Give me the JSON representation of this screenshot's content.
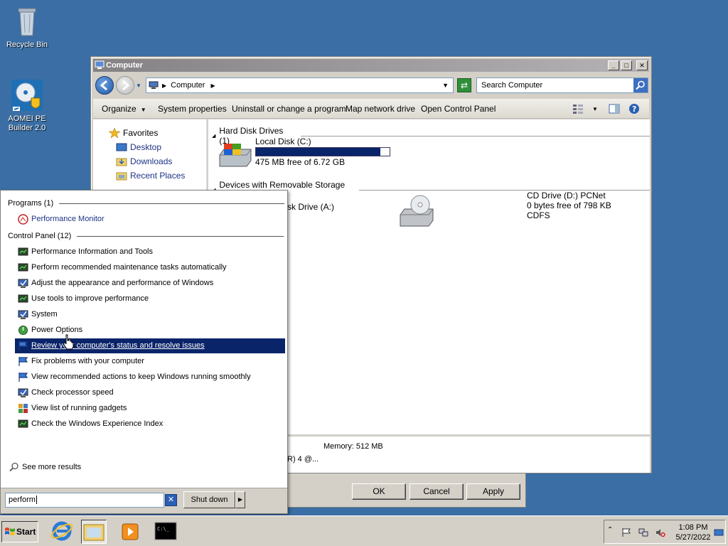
{
  "desktop": {
    "icons": [
      {
        "label": "Recycle Bin"
      },
      {
        "label": "AOMEI PE Builder 2.0"
      }
    ]
  },
  "explorer": {
    "title": "Computer",
    "address": "Computer",
    "search_placeholder": "Search Computer",
    "toolbar": {
      "organize": "Organize",
      "system_properties": "System properties",
      "uninstall": "Uninstall or change a program",
      "map_drive": "Map network drive",
      "open_cp": "Open Control Panel"
    },
    "nav": {
      "favorites": "Favorites",
      "desktop": "Desktop",
      "downloads": "Downloads",
      "recent": "Recent Places"
    },
    "groups": {
      "hdd": "Hard Disk Drives (1)",
      "removable": "Devices with Removable Storage (2)"
    },
    "local_disk": {
      "name": "Local Disk (C:)",
      "free": "475 MB free of 6.72 GB",
      "used_fraction": 0.93
    },
    "floppy": {
      "name_partial": "sk Drive (A:)"
    },
    "cd": {
      "name": "CD Drive (D:) PCNet",
      "free": "0 bytes free of 798 KB",
      "fs": "CDFS"
    },
    "details": {
      "memory": "Memory: 512 MB",
      "cpu_partial": "R) 4   @..."
    }
  },
  "dialog": {
    "ok": "OK",
    "cancel": "Cancel",
    "apply": "Apply"
  },
  "start_menu": {
    "programs_header": "Programs (1)",
    "programs": [
      {
        "label": "Performance Monitor"
      }
    ],
    "cp_header": "Control Panel (12)",
    "control_panel": [
      {
        "label": "Performance Information and Tools"
      },
      {
        "label": "Perform recommended maintenance tasks automatically"
      },
      {
        "label": "Adjust the appearance and performance of Windows"
      },
      {
        "label": "Use tools to improve performance"
      },
      {
        "label": "System"
      },
      {
        "label": "Power Options"
      },
      {
        "label": "Review your computer's status and resolve issues"
      },
      {
        "label": "Fix problems with your computer"
      },
      {
        "label": "View recommended actions to keep Windows running smoothly"
      },
      {
        "label": "Check processor speed"
      },
      {
        "label": "View list of running gadgets"
      },
      {
        "label": "Check the Windows Experience Index"
      }
    ],
    "see_more": "See more results",
    "search_value": "perform",
    "shutdown": "Shut down"
  },
  "taskbar": {
    "start": "Start",
    "time": "1:08 PM",
    "date": "5/27/2022"
  }
}
